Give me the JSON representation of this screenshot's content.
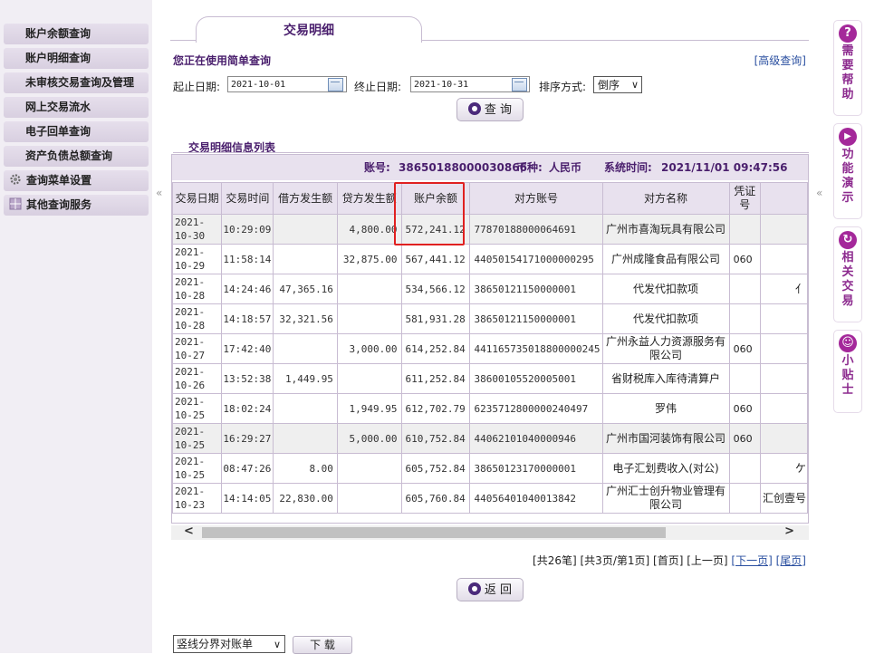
{
  "sidebar": {
    "items": [
      {
        "label": "账户余额查询"
      },
      {
        "label": "账户明细查询"
      },
      {
        "label": "未审核交易查询及管理"
      },
      {
        "label": "网上交易流水"
      },
      {
        "label": "电子回单查询"
      },
      {
        "label": "资产负债总额查询"
      },
      {
        "label": "查询菜单设置",
        "icon": "gear-icon"
      },
      {
        "label": "其他查询服务",
        "icon": "grid-icon"
      }
    ],
    "collapse_glyph": "«"
  },
  "main": {
    "tab_label": "交易明细",
    "using_label": "您正在使用简单查询",
    "advanced_link": "[高级查询]",
    "start_label": "起止日期:",
    "start_value": "2021-10-01",
    "end_label": "终止日期:",
    "end_value": "2021-10-31",
    "sort_label": "排序方式:",
    "sort_value": "倒序",
    "query_button": "查 询",
    "list_title": "交易明细信息列表",
    "account_label": "账号:",
    "account_value": "38650188000030866",
    "currency_label": "币种:",
    "currency_value": "人民币",
    "systime_label": "系统时间:",
    "systime_value": "2021/11/01 09:47:56",
    "columns": [
      "交易日期",
      "交易时间",
      "借方发生额",
      "贷方发生额",
      "账户余额",
      "对方账号",
      "对方名称",
      "凭证号",
      ""
    ],
    "rows": [
      {
        "date": "2021-10-30",
        "time": "10:29:09",
        "debit": "",
        "credit": "4,800.00",
        "balance": "572,241.12",
        "account": "77870188000064691",
        "name": "广州市喜淘玩具有限公司",
        "voucher": "",
        "extra": ""
      },
      {
        "date": "2021-10-29",
        "time": "11:58:14",
        "debit": "",
        "credit": "32,875.00",
        "balance": "567,441.12",
        "account": "44050154171000000295",
        "name": "广州成隆食品有限公司",
        "voucher": "060",
        "extra": ""
      },
      {
        "date": "2021-10-28",
        "time": "14:24:46",
        "debit": "47,365.16",
        "credit": "",
        "balance": "534,566.12",
        "account": "38650121150000001",
        "name": "代发代扣款项",
        "voucher": "",
        "extra": "亻"
      },
      {
        "date": "2021-10-28",
        "time": "14:18:57",
        "debit": "32,321.56",
        "credit": "",
        "balance": "581,931.28",
        "account": "38650121150000001",
        "name": "代发代扣款项",
        "voucher": "",
        "extra": ""
      },
      {
        "date": "2021-10-27",
        "time": "17:42:40",
        "debit": "",
        "credit": "3,000.00",
        "balance": "614,252.84",
        "account": "44116573501880000024​5",
        "name": "广州永益人力资源服务有限公司",
        "voucher": "060",
        "extra": ""
      },
      {
        "date": "2021-10-26",
        "time": "13:52:38",
        "debit": "1,449.95",
        "credit": "",
        "balance": "611,252.84",
        "account": "38600105520005001",
        "name": "省财税库入库待清算户",
        "voucher": "",
        "extra": ""
      },
      {
        "date": "2021-10-25",
        "time": "18:02:24",
        "debit": "",
        "credit": "1,949.95",
        "balance": "612,702.79",
        "account": "6235712800000240497",
        "name": "罗伟",
        "voucher": "060",
        "extra": ""
      },
      {
        "date": "2021-10-25",
        "time": "16:29:27",
        "debit": "",
        "credit": "5,000.00",
        "balance": "610,752.84",
        "account": "44062101040000946",
        "name": "广州市国河装饰有限公司",
        "voucher": "060",
        "extra": ""
      },
      {
        "date": "2021-10-25",
        "time": "08:47:26",
        "debit": "8.00",
        "credit": "",
        "balance": "605,752.84",
        "account": "38650123170000001",
        "name": "电子汇划费收入(对公)",
        "voucher": "",
        "extra": "ケ"
      },
      {
        "date": "2021-10-23",
        "time": "14:14:05",
        "debit": "22,830.00",
        "credit": "",
        "balance": "605,760.84",
        "account": "44056401040013842",
        "name": "广州汇士创升物业管理有限公司",
        "voucher": "",
        "extra": "汇创壹号"
      }
    ],
    "pager": {
      "total": "[共26笔]",
      "pages": "[共3页/第1页]",
      "first": "[首页]",
      "prev": "[上一页]",
      "next": "[下一页]",
      "last": "[尾页]"
    },
    "back_button": "返 回",
    "export_select": "竖线分界对账单",
    "download_button": "下 载"
  },
  "help": {
    "items": [
      {
        "icon": "question-icon",
        "glyph": "?",
        "label": "需要帮助"
      },
      {
        "icon": "play-icon",
        "glyph": "▶",
        "label": "功能演示"
      },
      {
        "icon": "refresh-icon",
        "glyph": "↻",
        "label": "相关交易"
      },
      {
        "icon": "smile-icon",
        "glyph": "☺",
        "label": "小贴士"
      }
    ]
  },
  "colors": {
    "accent": "#4a1f6d",
    "header_bg": "#e8e1ee",
    "help_accent": "#a4289a",
    "highlight": "#e02020"
  }
}
